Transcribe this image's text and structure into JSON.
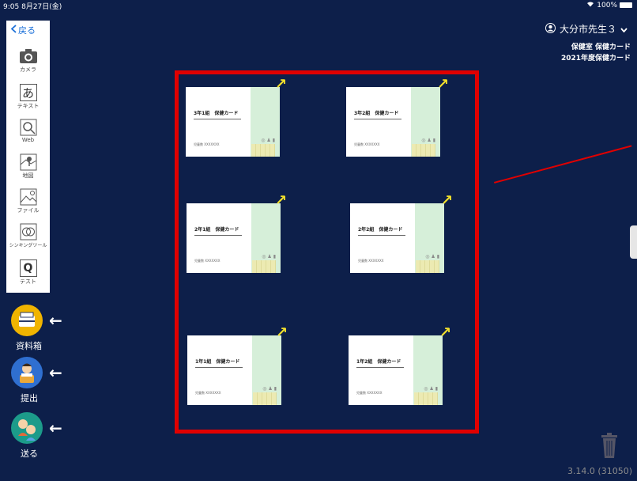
{
  "status": {
    "time": "9:05",
    "date": "8月27日(金)",
    "battery": "100%"
  },
  "toolbar": {
    "back": "戻る",
    "tools": [
      {
        "label": "カメラ",
        "icon": "camera-icon"
      },
      {
        "label": "テキスト",
        "icon": "text-icon",
        "glyph": "あ"
      },
      {
        "label": "Web",
        "icon": "web-search-icon"
      },
      {
        "label": "地図",
        "icon": "map-icon"
      },
      {
        "label": "ファイル",
        "icon": "file-icon"
      },
      {
        "label": "シンキングツール",
        "icon": "thinking-tool-icon"
      },
      {
        "label": "テスト",
        "icon": "test-icon",
        "glyph": "Q"
      }
    ]
  },
  "side": {
    "materials": "資料箱",
    "submit": "提出",
    "send": "送る"
  },
  "header": {
    "user": "大分市先生３",
    "crumb1": "保健室 保健カード",
    "crumb2": "2021年度保健カード"
  },
  "cards": [
    {
      "title": "3年1組　保健カード",
      "footer": "児童数 XXXXXXX"
    },
    {
      "title": "3年2組　保健カード",
      "footer": "児童数 XXXXXXX"
    },
    {
      "title": "2年1組　保健カード",
      "footer": "児童数 XXXXXXX"
    },
    {
      "title": "2年2組　保健カード",
      "footer": "児童数 XXXXXXX"
    },
    {
      "title": "1年1組　保健カード",
      "footer": "児童数 XXXXXXX"
    },
    {
      "title": "1年2組　保健カード",
      "footer": "児童数 XXXXXXX"
    }
  ],
  "version": "3.14.0 (31050)",
  "colors": {
    "background": "#0d1f4a",
    "highlight": "#e00000",
    "arrow": "#f2e02c",
    "card_accent": "#d6efd9"
  }
}
